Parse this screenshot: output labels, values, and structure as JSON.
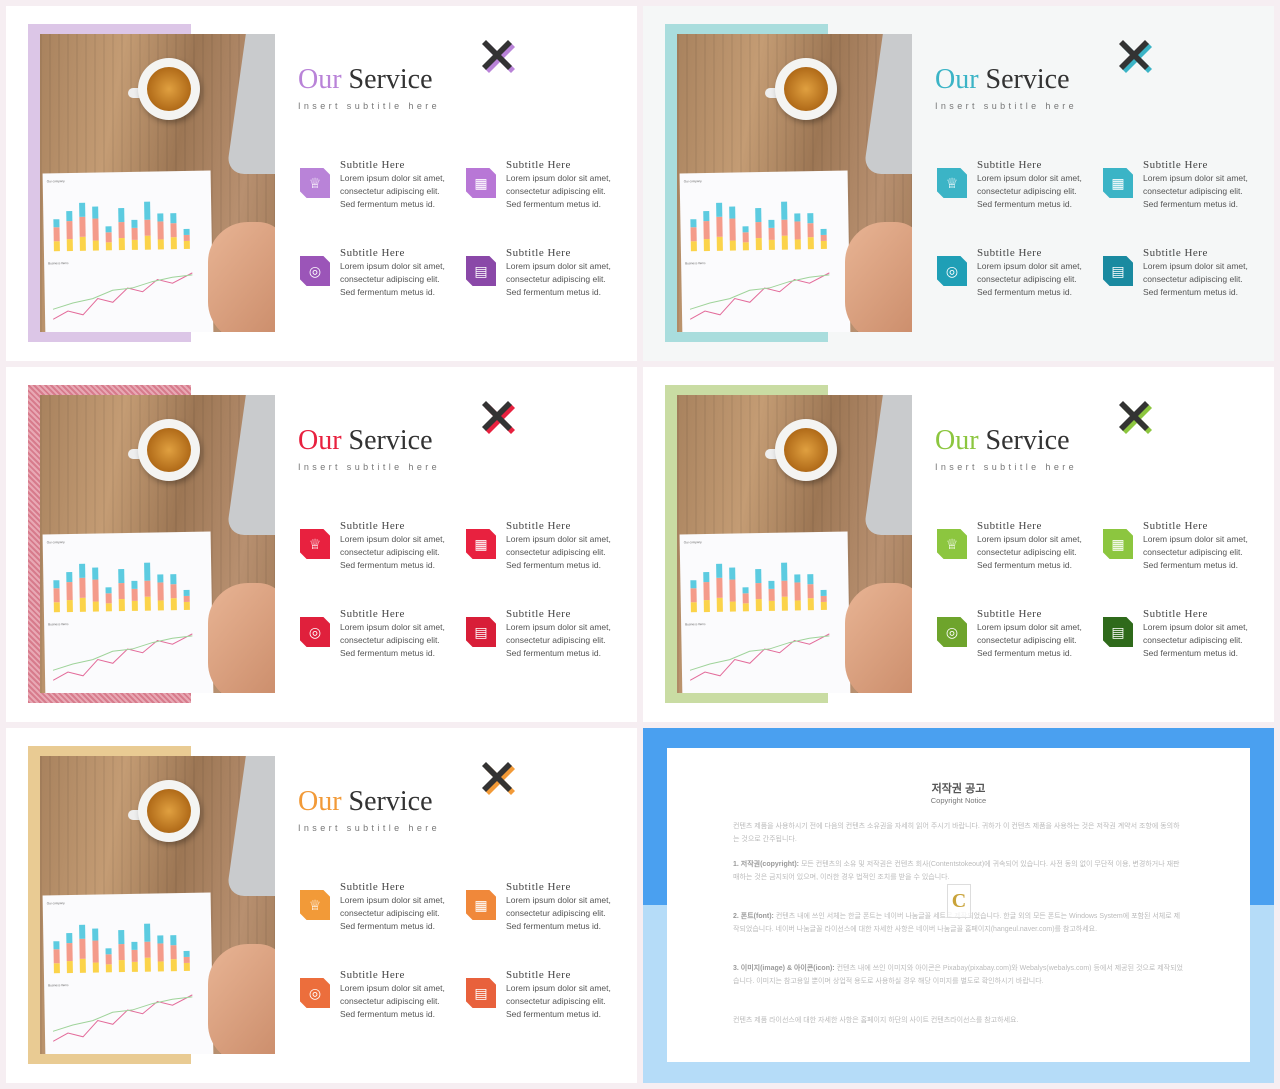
{
  "slides": [
    {
      "accent": "#b983d8",
      "frame": "#dcc6e7",
      "icon_colors": [
        "#b983d8",
        "#b877d6",
        "#9b55b8",
        "#8a48a8"
      ],
      "x_shadow": "#b983d8"
    },
    {
      "accent": "#3bb4c6",
      "frame": "#a9dddd",
      "icon_colors": [
        "#3bb4c6",
        "#3bb4c6",
        "#1f9fb6",
        "#1a8aa0"
      ],
      "x_shadow": "#3bb4c6",
      "bg": "#f5f7f7"
    },
    {
      "accent": "#e8213f",
      "frame": "#d77b8c",
      "icon_colors": [
        "#e8213f",
        "#e8213f",
        "#e0203c",
        "#d81e38"
      ],
      "x_shadow": "#e8213f"
    },
    {
      "accent": "#8cc63f",
      "frame": "#c9dca3",
      "icon_colors": [
        "#8cc63f",
        "#8cc63f",
        "#6ea42c",
        "#2f6a1b"
      ],
      "x_shadow": "#8cc63f"
    },
    {
      "accent": "#f29a38",
      "frame": "#e9cb93",
      "icon_colors": [
        "#f29a38",
        "#f0883a",
        "#ec6e3c",
        "#e8613c"
      ],
      "x_shadow": "#f29a38"
    }
  ],
  "content": {
    "title_first": "Our",
    "title_second": "Service",
    "subtitle": "Insert subtitle here",
    "features": [
      {
        "heading": "Subtitle Here",
        "lines": [
          "Lorem ipsum dolor sit amet,",
          "consectetur adipiscing elit.",
          "Sed fermentum metus id."
        ],
        "icon": "trophy-icon"
      },
      {
        "heading": "Subtitle Here",
        "lines": [
          "Lorem ipsum dolor sit amet,",
          "consectetur adipiscing elit.",
          "Sed fermentum metus id."
        ],
        "icon": "store-icon"
      },
      {
        "heading": "Subtitle Here",
        "lines": [
          "Lorem ipsum dolor sit amet,",
          "consectetur adipiscing elit.",
          "Sed fermentum metus id."
        ],
        "icon": "location-pin-icon"
      },
      {
        "heading": "Subtitle Here",
        "lines": [
          "Lorem ipsum dolor sit amet,",
          "consectetur adipiscing elit.",
          "Sed fermentum metus id."
        ],
        "icon": "newspaper-icon"
      }
    ],
    "paper_labels": {
      "chart1": "Our company",
      "chart2": "Business Items"
    }
  },
  "notice": {
    "title": "저작권 공고",
    "subtitle": "Copyright Notice",
    "intro": "컨텐츠 제품을 사용하시기 전에 다음의 컨텐츠 소유권을 자세히 읽어 주시기 바랍니다. 귀하가 이 컨텐츠 제품을 사용하는 것은 저작권 계약서 조항에 동의하는 것으로 간주됩니다.",
    "items": [
      {
        "label": "1. 저작권(copyright):",
        "text": "모든 컨텐츠의 소유 및 저작권은 컨텐츠 회사(Contentstokeout)에 귀속되어 있습니다. 사전 동의 없이 무단적 이용, 변경하거나 재판매하는 것은 금지되어 있으며, 이러한 경우 법적인 조치를 받을 수 있습니다."
      },
      {
        "label": "2. 폰트(font):",
        "text": "컨텐츠 내에 쓰인 서체는 한글 폰트는 네이버 나눔글꼴 세트로 제작되었습니다. 한글 외의 모든 폰트는 Windows System에 포함된 서체로 제작되었습니다. 네이버 나눔글꼴 라이선스에 대한 자세한 사항은 네이버 나눔글꼴 홈페이지(hangeul.naver.com)를 참고하세요."
      },
      {
        "label": "3. 이미지(image) & 아이콘(icon):",
        "text": "컨텐츠 내에 쓰인 이미지와 아이콘은 Pixabay(pixabay.com)와 Webalys(webalys.com) 등에서 제공된 것으로 제작되었습니다. 이미지는 참고용일 뿐이며 상업적 용도로 사용하실 경우 해당 이미지를 별도로 확인하시기 바랍니다."
      }
    ],
    "outro": "컨텐츠 제품 라이선스에 대한 자세한 사항은 홈페이지 하단의 사이트 컨텐츠라이선스를 참고하세요.",
    "colors": {
      "top": "#4aa0f0",
      "bottom": "#b5dcf8"
    }
  }
}
